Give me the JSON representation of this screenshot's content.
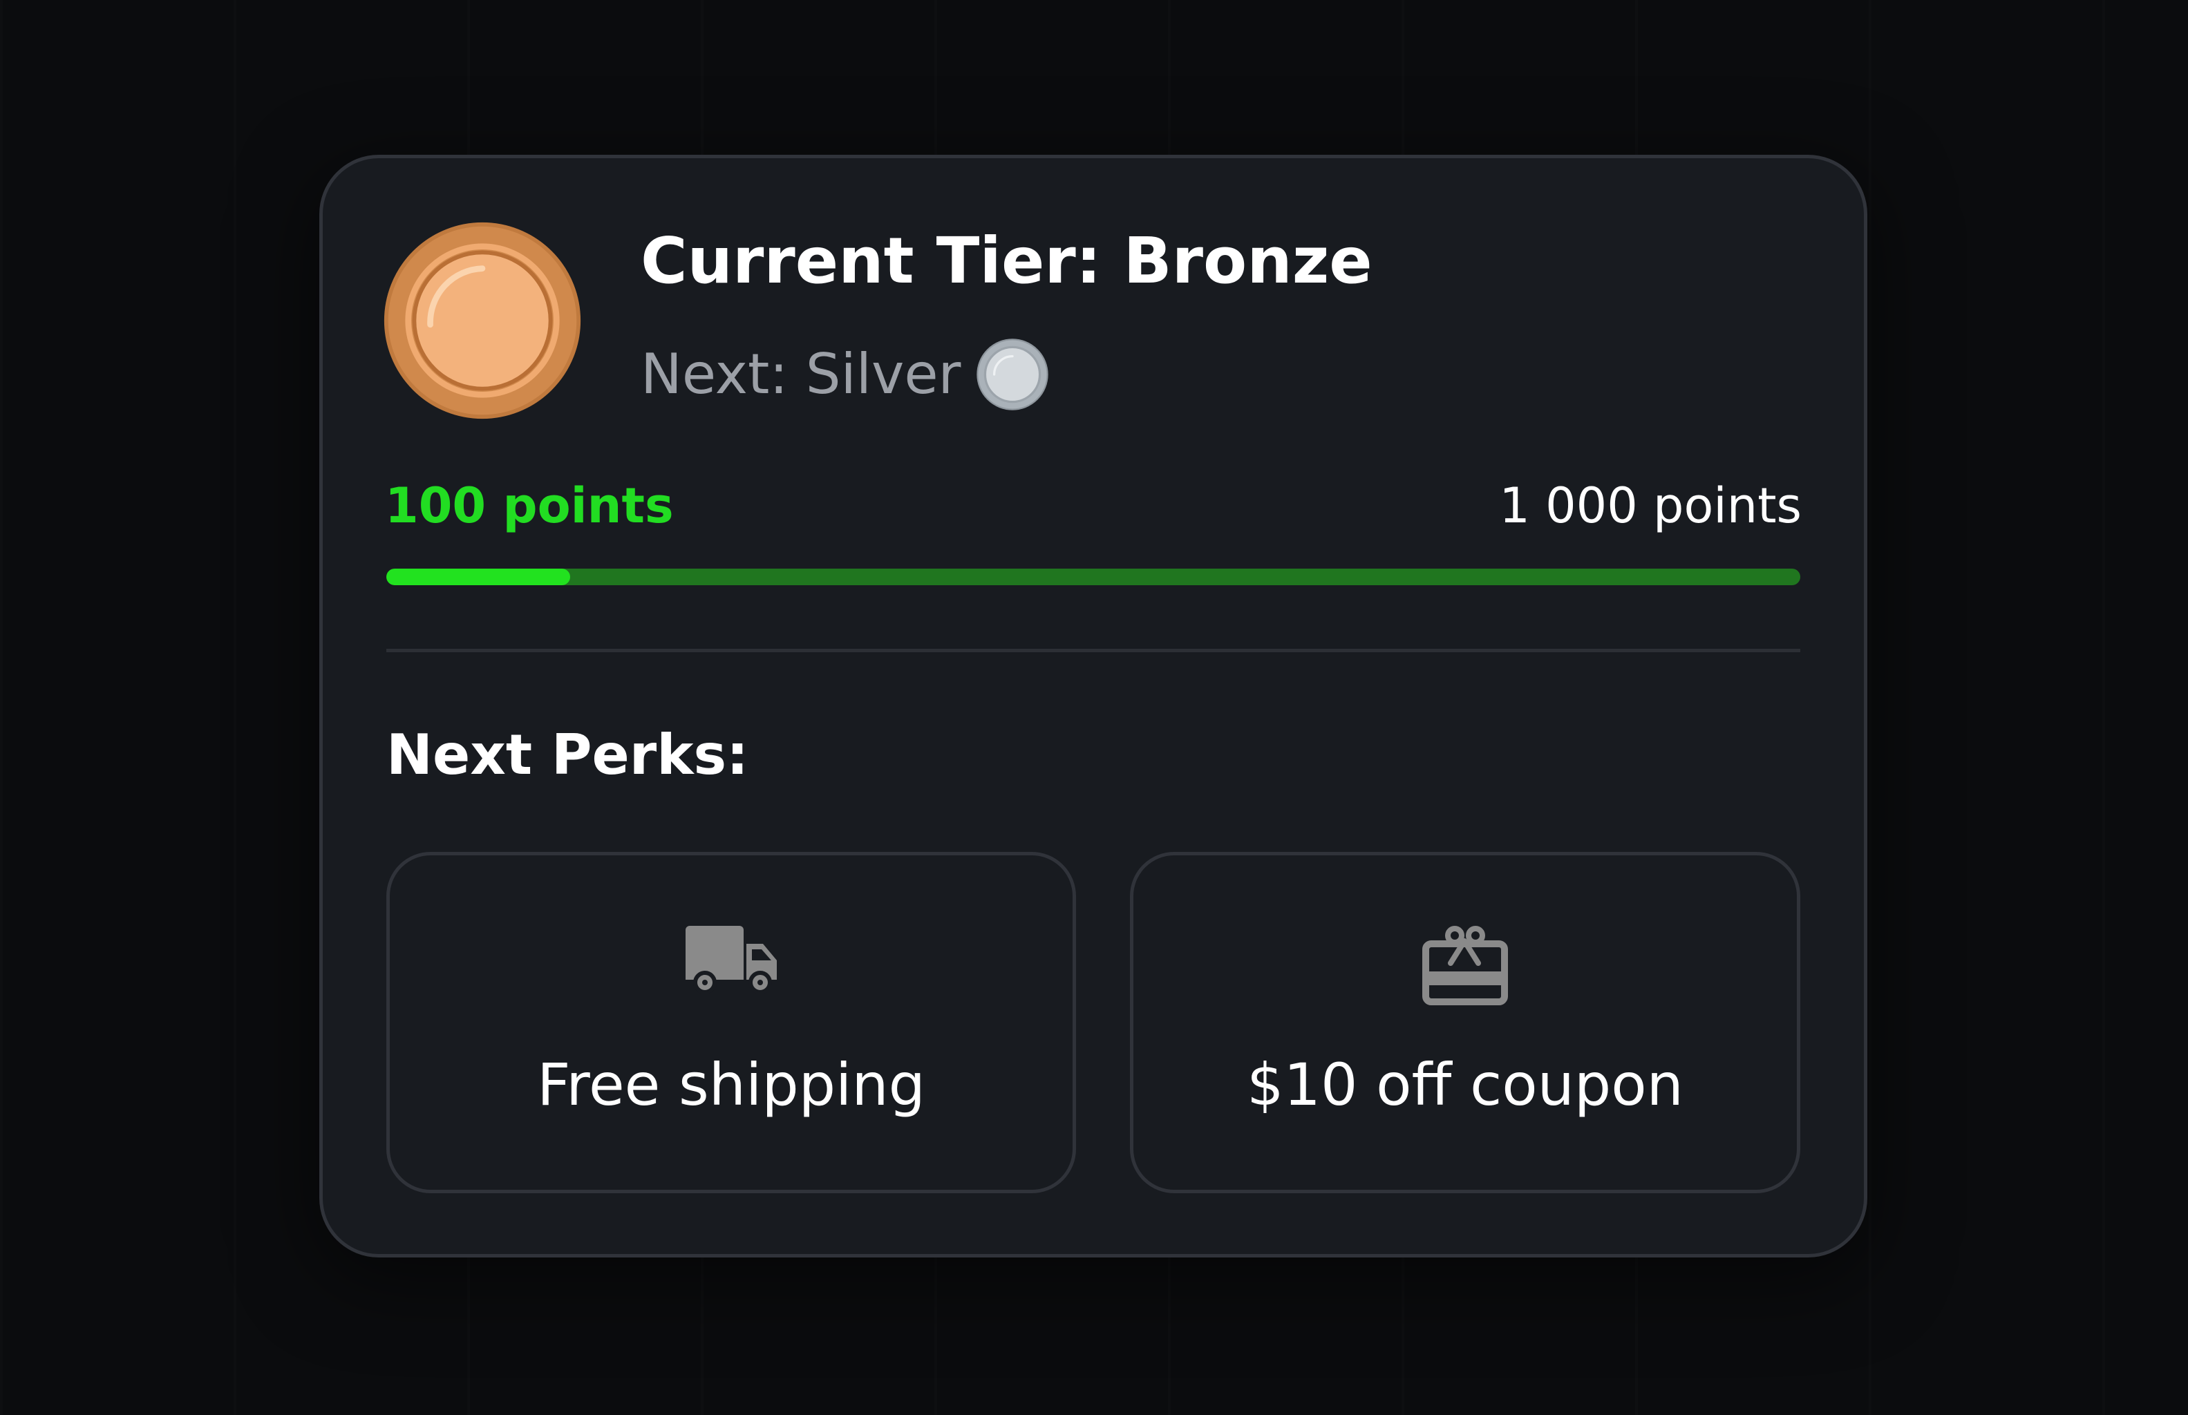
{
  "tier": {
    "current_title": "Current Tier: Bronze",
    "next_label": "Next: Silver",
    "current_icon": "bronze-coin-icon",
    "next_icon": "silver-coin-icon"
  },
  "points": {
    "current_label": "100 points",
    "goal_label": "1 000 points",
    "current": 100,
    "goal": 1000,
    "progress_fraction": 0.1
  },
  "perks": {
    "heading": "Next Perks:",
    "items": [
      {
        "label": "Free shipping",
        "icon": "truck-icon"
      },
      {
        "label": "$10 off coupon",
        "icon": "gift-card-icon"
      }
    ]
  },
  "colors": {
    "accent_green": "#22dd22",
    "progress_track": "#20761f",
    "bronze": "#f3b27c",
    "silver": "#c9ced3",
    "card_bg": "#181b20"
  }
}
